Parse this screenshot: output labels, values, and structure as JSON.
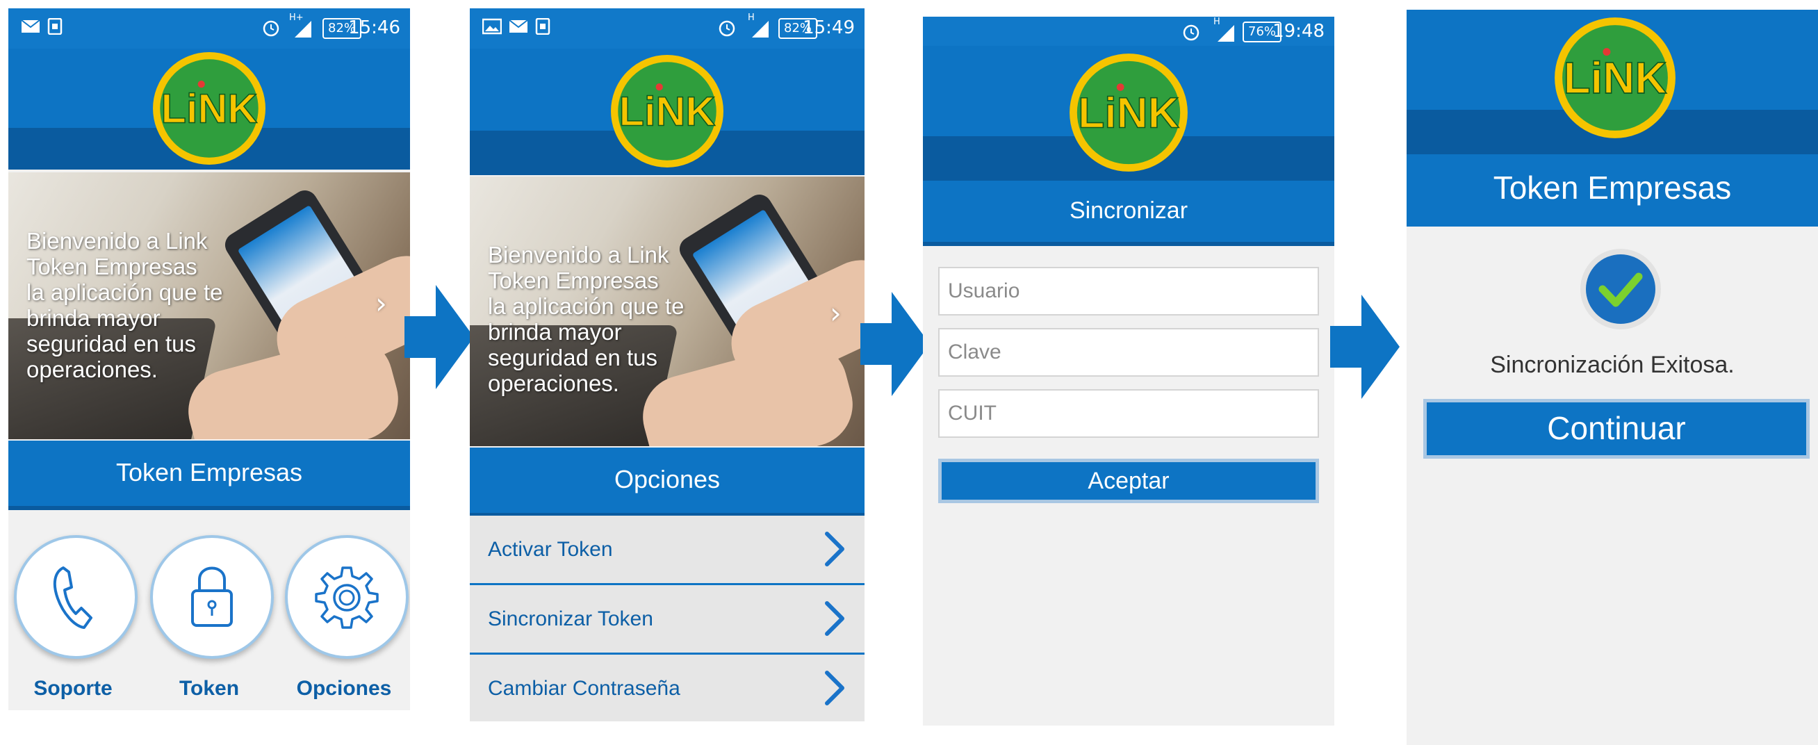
{
  "colors": {
    "primary": "#0d74c4",
    "dark_band": "#0a5b9f",
    "logo_ring": "#f5c400",
    "logo_green": "#2f9e3d"
  },
  "logo": {
    "text": "LiNK"
  },
  "screens": [
    {
      "status": {
        "time": "15:46",
        "battery": "82%",
        "network": "H+"
      },
      "hero_text": "Bienvenido a Link\nToken Empresas\nla aplicación que te\nbrinda mayor\nseguridad en tus\noperaciones.",
      "title": "Token Empresas",
      "buttons": [
        {
          "label": "Soporte",
          "icon": "phone-icon"
        },
        {
          "label": "Token",
          "icon": "lock-icon"
        },
        {
          "label": "Opciones",
          "icon": "gear-icon"
        }
      ]
    },
    {
      "status": {
        "time": "15:49",
        "battery": "82%",
        "network": "H"
      },
      "hero_text": "Bienvenido a Link\nToken Empresas\nla aplicación que te\nbrinda mayor\nseguridad en tus\noperaciones.",
      "title": "Opciones",
      "menu": [
        {
          "label": "Activar Token"
        },
        {
          "label": "Sincronizar Token"
        },
        {
          "label": "Cambiar Contraseña"
        }
      ]
    },
    {
      "status": {
        "time": "19:48",
        "battery": "76%",
        "network": "H"
      },
      "title": "Sincronizar",
      "fields": [
        {
          "placeholder": "Usuario"
        },
        {
          "placeholder": "Clave"
        },
        {
          "placeholder": "CUIT"
        }
      ],
      "submit_label": "Aceptar"
    },
    {
      "title": "Token Empresas",
      "success_icon": "check-icon",
      "message": "Sincronización Exitosa.",
      "continue_label": "Continuar"
    }
  ],
  "flow_arrows": [
    "arrow-right-icon",
    "arrow-right-icon",
    "arrow-right-icon"
  ]
}
